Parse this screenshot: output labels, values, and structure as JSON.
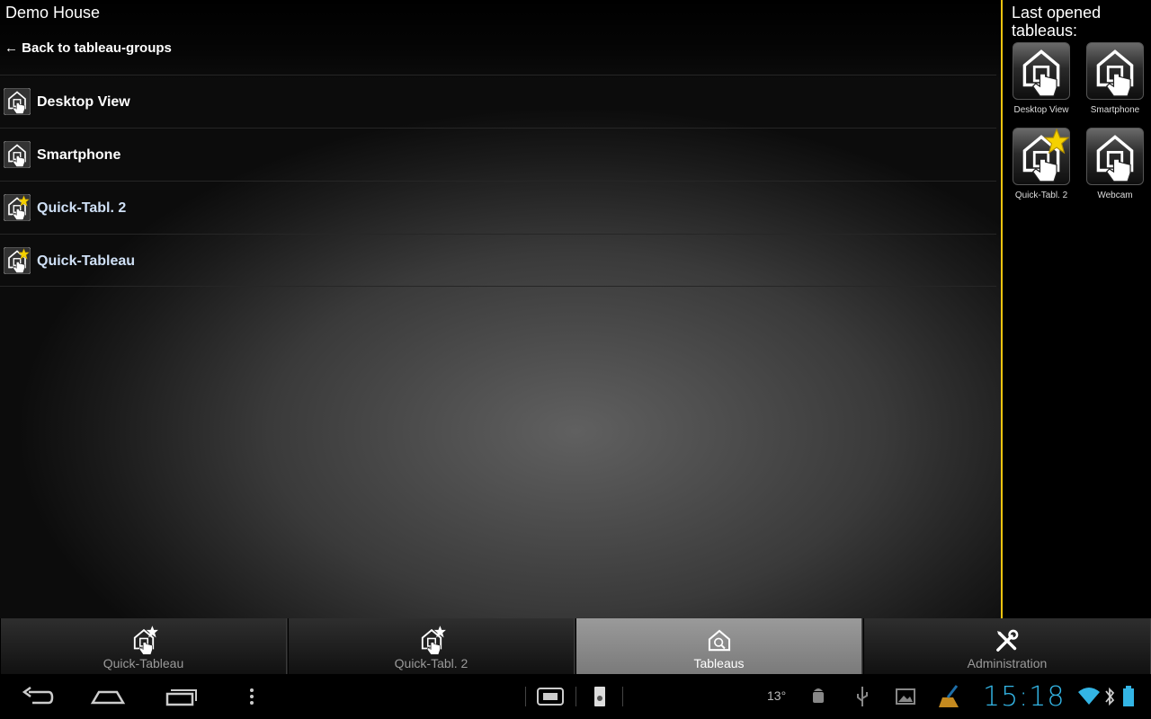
{
  "app": {
    "title": "Demo House"
  },
  "nav": {
    "back_label": "← Back to tableau-groups"
  },
  "list": {
    "items": [
      {
        "label": "Desktop View",
        "starred": false
      },
      {
        "label": "Smartphone",
        "starred": false
      },
      {
        "label": "Quick-Tabl. 2",
        "starred": true
      },
      {
        "label": "Quick-Tableau",
        "starred": true
      }
    ]
  },
  "sidebar": {
    "title": "Last opened tableaus:",
    "tiles": [
      {
        "label": "Desktop View",
        "starred": false
      },
      {
        "label": "Smartphone",
        "starred": false
      },
      {
        "label": "Quick-Tabl. 2",
        "starred": true
      },
      {
        "label": "Webcam",
        "starred": false
      }
    ]
  },
  "tabs": [
    {
      "label": "Quick-Tableau",
      "icon": "house-star-icon",
      "active": false
    },
    {
      "label": "Quick-Tabl. 2",
      "icon": "house-star-icon",
      "active": false
    },
    {
      "label": "Tableaus",
      "icon": "house-search-icon",
      "active": true
    },
    {
      "label": "Administration",
      "icon": "tools-icon",
      "active": false
    }
  ],
  "system_bar": {
    "temperature": "13°",
    "time": "15:18"
  },
  "colors": {
    "accent": "#f1c40f",
    "clock": "#33b5e5",
    "link_blue": "#cfe0f6"
  }
}
